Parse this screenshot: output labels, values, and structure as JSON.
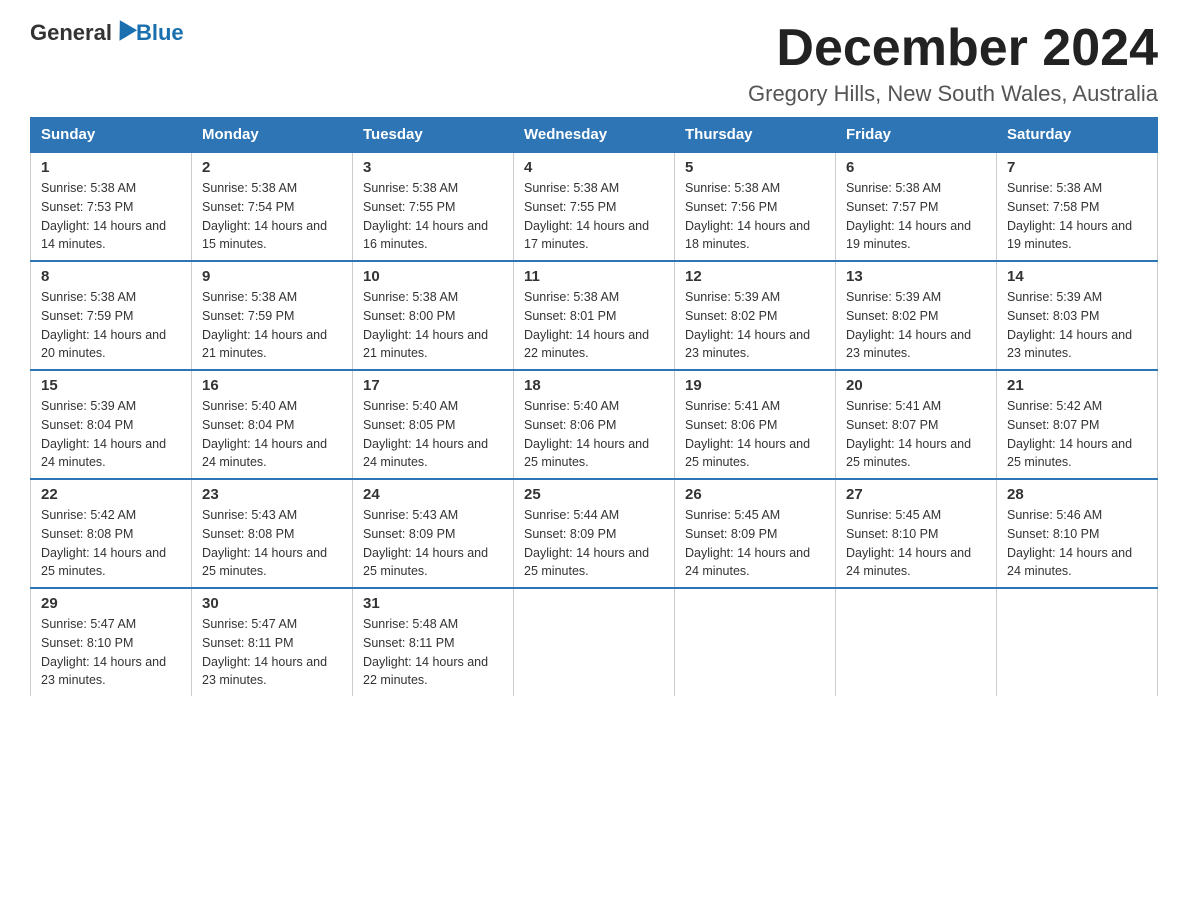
{
  "header": {
    "logo_general": "General",
    "logo_blue": "Blue",
    "month_title": "December 2024",
    "location": "Gregory Hills, New South Wales, Australia"
  },
  "days_of_week": [
    "Sunday",
    "Monday",
    "Tuesday",
    "Wednesday",
    "Thursday",
    "Friday",
    "Saturday"
  ],
  "weeks": [
    [
      {
        "day": "1",
        "sunrise": "5:38 AM",
        "sunset": "7:53 PM",
        "daylight": "14 hours and 14 minutes."
      },
      {
        "day": "2",
        "sunrise": "5:38 AM",
        "sunset": "7:54 PM",
        "daylight": "14 hours and 15 minutes."
      },
      {
        "day": "3",
        "sunrise": "5:38 AM",
        "sunset": "7:55 PM",
        "daylight": "14 hours and 16 minutes."
      },
      {
        "day": "4",
        "sunrise": "5:38 AM",
        "sunset": "7:55 PM",
        "daylight": "14 hours and 17 minutes."
      },
      {
        "day": "5",
        "sunrise": "5:38 AM",
        "sunset": "7:56 PM",
        "daylight": "14 hours and 18 minutes."
      },
      {
        "day": "6",
        "sunrise": "5:38 AM",
        "sunset": "7:57 PM",
        "daylight": "14 hours and 19 minutes."
      },
      {
        "day": "7",
        "sunrise": "5:38 AM",
        "sunset": "7:58 PM",
        "daylight": "14 hours and 19 minutes."
      }
    ],
    [
      {
        "day": "8",
        "sunrise": "5:38 AM",
        "sunset": "7:59 PM",
        "daylight": "14 hours and 20 minutes."
      },
      {
        "day": "9",
        "sunrise": "5:38 AM",
        "sunset": "7:59 PM",
        "daylight": "14 hours and 21 minutes."
      },
      {
        "day": "10",
        "sunrise": "5:38 AM",
        "sunset": "8:00 PM",
        "daylight": "14 hours and 21 minutes."
      },
      {
        "day": "11",
        "sunrise": "5:38 AM",
        "sunset": "8:01 PM",
        "daylight": "14 hours and 22 minutes."
      },
      {
        "day": "12",
        "sunrise": "5:39 AM",
        "sunset": "8:02 PM",
        "daylight": "14 hours and 23 minutes."
      },
      {
        "day": "13",
        "sunrise": "5:39 AM",
        "sunset": "8:02 PM",
        "daylight": "14 hours and 23 minutes."
      },
      {
        "day": "14",
        "sunrise": "5:39 AM",
        "sunset": "8:03 PM",
        "daylight": "14 hours and 23 minutes."
      }
    ],
    [
      {
        "day": "15",
        "sunrise": "5:39 AM",
        "sunset": "8:04 PM",
        "daylight": "14 hours and 24 minutes."
      },
      {
        "day": "16",
        "sunrise": "5:40 AM",
        "sunset": "8:04 PM",
        "daylight": "14 hours and 24 minutes."
      },
      {
        "day": "17",
        "sunrise": "5:40 AM",
        "sunset": "8:05 PM",
        "daylight": "14 hours and 24 minutes."
      },
      {
        "day": "18",
        "sunrise": "5:40 AM",
        "sunset": "8:06 PM",
        "daylight": "14 hours and 25 minutes."
      },
      {
        "day": "19",
        "sunrise": "5:41 AM",
        "sunset": "8:06 PM",
        "daylight": "14 hours and 25 minutes."
      },
      {
        "day": "20",
        "sunrise": "5:41 AM",
        "sunset": "8:07 PM",
        "daylight": "14 hours and 25 minutes."
      },
      {
        "day": "21",
        "sunrise": "5:42 AM",
        "sunset": "8:07 PM",
        "daylight": "14 hours and 25 minutes."
      }
    ],
    [
      {
        "day": "22",
        "sunrise": "5:42 AM",
        "sunset": "8:08 PM",
        "daylight": "14 hours and 25 minutes."
      },
      {
        "day": "23",
        "sunrise": "5:43 AM",
        "sunset": "8:08 PM",
        "daylight": "14 hours and 25 minutes."
      },
      {
        "day": "24",
        "sunrise": "5:43 AM",
        "sunset": "8:09 PM",
        "daylight": "14 hours and 25 minutes."
      },
      {
        "day": "25",
        "sunrise": "5:44 AM",
        "sunset": "8:09 PM",
        "daylight": "14 hours and 25 minutes."
      },
      {
        "day": "26",
        "sunrise": "5:45 AM",
        "sunset": "8:09 PM",
        "daylight": "14 hours and 24 minutes."
      },
      {
        "day": "27",
        "sunrise": "5:45 AM",
        "sunset": "8:10 PM",
        "daylight": "14 hours and 24 minutes."
      },
      {
        "day": "28",
        "sunrise": "5:46 AM",
        "sunset": "8:10 PM",
        "daylight": "14 hours and 24 minutes."
      }
    ],
    [
      {
        "day": "29",
        "sunrise": "5:47 AM",
        "sunset": "8:10 PM",
        "daylight": "14 hours and 23 minutes."
      },
      {
        "day": "30",
        "sunrise": "5:47 AM",
        "sunset": "8:11 PM",
        "daylight": "14 hours and 23 minutes."
      },
      {
        "day": "31",
        "sunrise": "5:48 AM",
        "sunset": "8:11 PM",
        "daylight": "14 hours and 22 minutes."
      },
      null,
      null,
      null,
      null
    ]
  ]
}
